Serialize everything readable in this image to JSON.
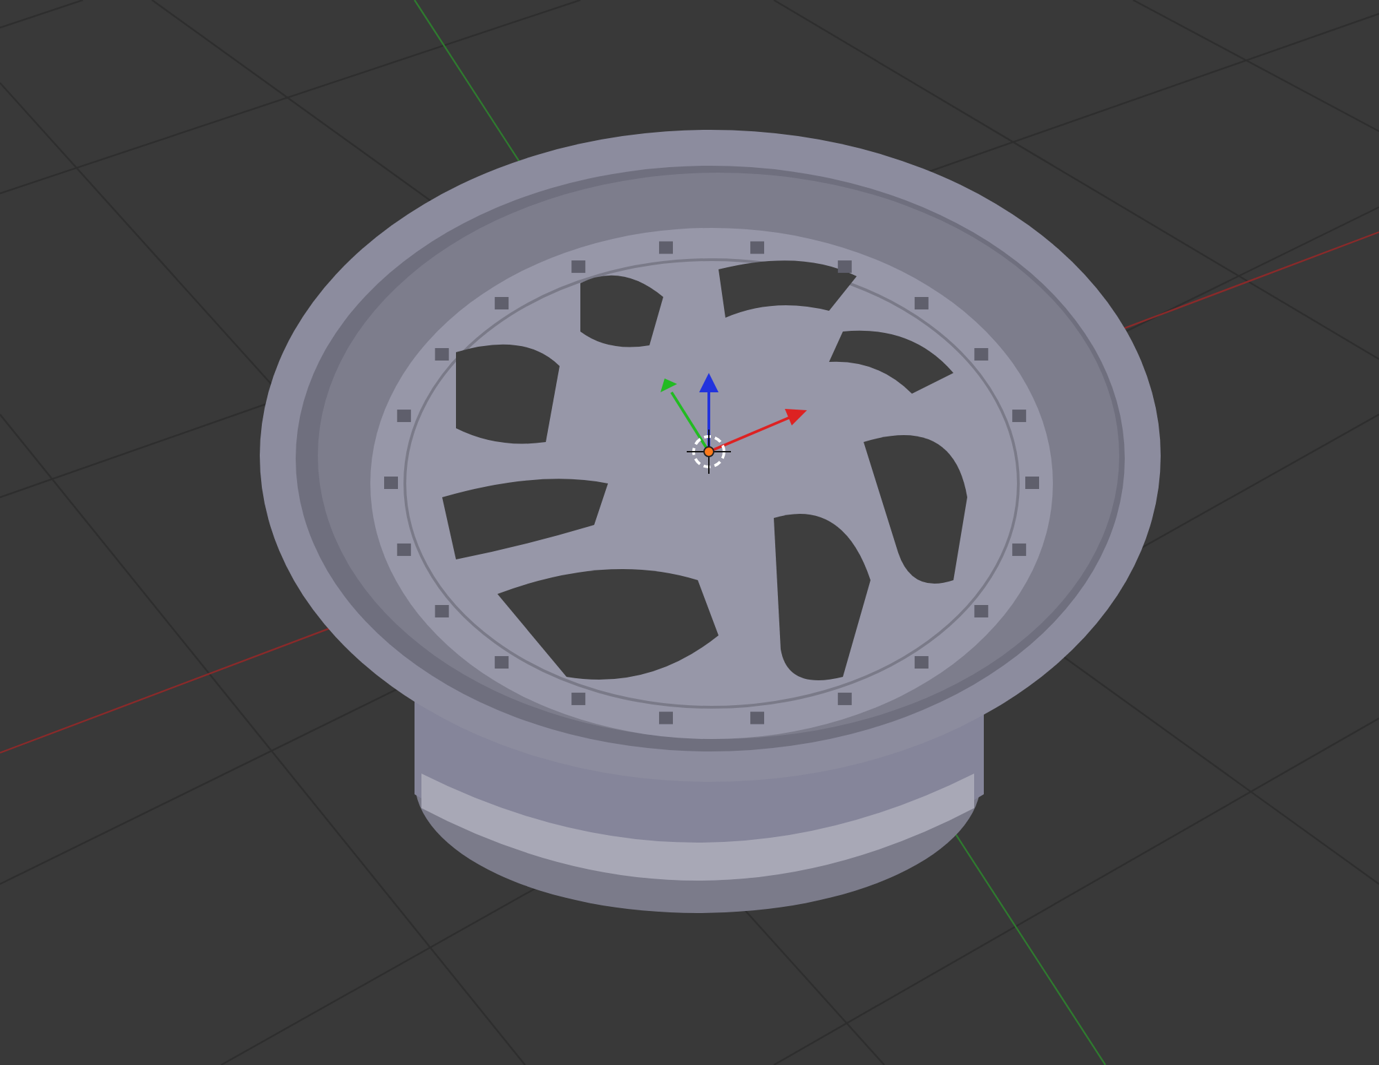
{
  "viewport": {
    "show_grid": true,
    "show_gizmo": true
  }
}
